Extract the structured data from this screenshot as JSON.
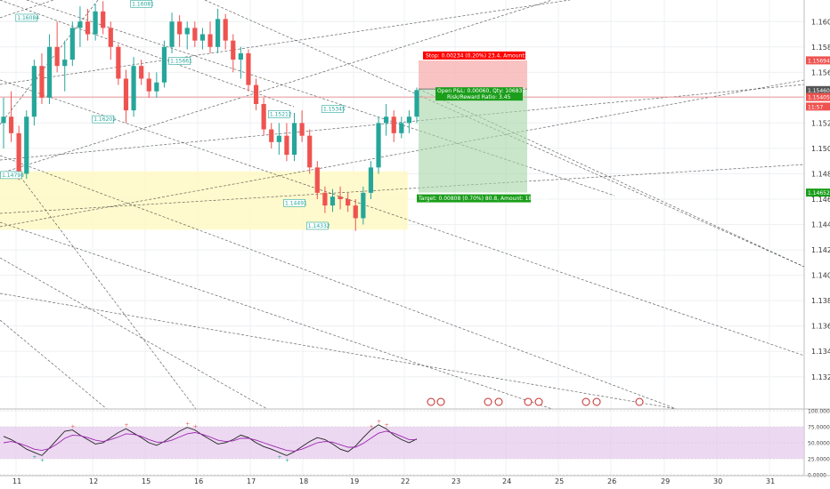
{
  "colors": {
    "up": "#26a69a",
    "down": "#ef5350",
    "stop_zone": "#f8b4b4",
    "target_zone": "#a5d6a7",
    "demand_zone": "#fff9c4",
    "stop_label_bg": "#ff0000",
    "target_label_bg": "#1b9e1b",
    "price_tag_red": "#ef5350",
    "price_tag_green": "#1b9e1b",
    "price_tag_gray": "#555555",
    "oscillator_band": "#e6c8ec"
  },
  "chart_data": [
    {
      "type": "candlestick",
      "symbol": "",
      "y_range": [
        1.1296,
        1.1617
      ],
      "y_ticks": [
        "1.16000",
        "1.15800",
        "1.15600",
        "1.15400",
        "1.15200",
        "1.15000",
        "1.14800",
        "1.14600",
        "1.14400",
        "1.14200",
        "1.14000",
        "1.13800",
        "1.13600",
        "1.13400",
        "1.13200"
      ],
      "x_ticks": [
        "11",
        "12",
        "15",
        "16",
        "17",
        "18",
        "19",
        "22",
        "23",
        "24",
        "25",
        "26",
        "29",
        "30",
        "31"
      ],
      "grid": true,
      "ohlc": [
        [
          1.152,
          1.154,
          1.15,
          1.1525
        ],
        [
          1.1525,
          1.1545,
          1.1505,
          1.1512
        ],
        [
          1.1512,
          1.1518,
          1.1475,
          1.148
        ],
        [
          1.148,
          1.153,
          1.1476,
          1.1525
        ],
        [
          1.1525,
          1.157,
          1.1518,
          1.1565
        ],
        [
          1.1565,
          1.1575,
          1.1535,
          1.154
        ],
        [
          1.154,
          1.159,
          1.1535,
          1.158
        ],
        [
          1.158,
          1.16,
          1.156,
          1.1565
        ],
        [
          1.1565,
          1.1585,
          1.1545,
          1.157
        ],
        [
          1.157,
          1.16,
          1.1565,
          1.1595
        ],
        [
          1.1595,
          1.1612,
          1.158,
          1.16
        ],
        [
          1.16,
          1.161,
          1.1585,
          1.159
        ],
        [
          1.159,
          1.1614,
          1.1585,
          1.1608
        ],
        [
          1.1608,
          1.1616,
          1.159,
          1.1595
        ],
        [
          1.1595,
          1.16,
          1.157,
          1.158
        ],
        [
          1.158,
          1.1582,
          1.155,
          1.1555
        ],
        [
          1.1555,
          1.1562,
          1.152,
          1.153
        ],
        [
          1.153,
          1.1572,
          1.1525,
          1.1565
        ],
        [
          1.1565,
          1.157,
          1.155,
          1.1555
        ],
        [
          1.1555,
          1.156,
          1.154,
          1.1545
        ],
        [
          1.1545,
          1.156,
          1.154,
          1.1552
        ],
        [
          1.1552,
          1.1585,
          1.1548,
          1.158
        ],
        [
          1.158,
          1.1607,
          1.1575,
          1.16
        ],
        [
          1.16,
          1.1605,
          1.158,
          1.159
        ],
        [
          1.159,
          1.16,
          1.1578,
          1.1595
        ],
        [
          1.1595,
          1.16,
          1.158,
          1.1585
        ],
        [
          1.1585,
          1.1595,
          1.1578,
          1.159
        ],
        [
          1.159,
          1.16,
          1.1575,
          1.158
        ],
        [
          1.158,
          1.161,
          1.1575,
          1.1602
        ],
        [
          1.1602,
          1.1606,
          1.1578,
          1.1585
        ],
        [
          1.1585,
          1.159,
          1.156,
          1.157
        ],
        [
          1.157,
          1.158,
          1.1555,
          1.1575
        ],
        [
          1.1575,
          1.1578,
          1.1545,
          1.155
        ],
        [
          1.155,
          1.1555,
          1.153,
          1.1535
        ],
        [
          1.1535,
          1.154,
          1.151,
          1.1515
        ],
        [
          1.1515,
          1.152,
          1.15,
          1.1505
        ],
        [
          1.1505,
          1.152,
          1.1495,
          1.151
        ],
        [
          1.151,
          1.152,
          1.149,
          1.1495
        ],
        [
          1.1495,
          1.1528,
          1.149,
          1.152
        ],
        [
          1.152,
          1.153,
          1.1505,
          1.151
        ],
        [
          1.151,
          1.1515,
          1.148,
          1.1485
        ],
        [
          1.1485,
          1.149,
          1.146,
          1.1465
        ],
        [
          1.1465,
          1.147,
          1.1449,
          1.1455
        ],
        [
          1.1455,
          1.1468,
          1.145,
          1.1462
        ],
        [
          1.1462,
          1.147,
          1.1452,
          1.146
        ],
        [
          1.146,
          1.1465,
          1.145,
          1.1455
        ],
        [
          1.1455,
          1.146,
          1.1435,
          1.1445
        ],
        [
          1.1445,
          1.147,
          1.144,
          1.1465
        ],
        [
          1.1465,
          1.149,
          1.146,
          1.1485
        ],
        [
          1.1485,
          1.1525,
          1.148,
          1.152
        ],
        [
          1.152,
          1.1535,
          1.151,
          1.1525
        ],
        [
          1.1525,
          1.153,
          1.1505,
          1.1512
        ],
        [
          1.1512,
          1.1525,
          1.1508,
          1.152
        ],
        [
          1.152,
          1.153,
          1.1512,
          1.1525
        ],
        [
          1.1525,
          1.1548,
          1.152,
          1.1546
        ]
      ],
      "price_labels": [
        {
          "text": "1.16084",
          "date_index": 3,
          "price": 1.1603
        },
        {
          "text": "1.16081",
          "date_index": 18,
          "price": 1.1614
        },
        {
          "text": "1.15661",
          "date_index": 23,
          "price": 1.1569
        },
        {
          "text": "1.16202",
          "date_index": 13,
          "price": 1.1523
        },
        {
          "text": "1.14798",
          "date_index": 1,
          "price": 1.1479
        },
        {
          "text": "1.15212",
          "date_index": 36,
          "price": 1.1527
        },
        {
          "text": "1.15345",
          "date_index": 43,
          "price": 1.1531
        },
        {
          "text": "1.14491",
          "date_index": 38,
          "price": 1.1457
        },
        {
          "text": "1.14332",
          "date_index": 41,
          "price": 1.1439
        }
      ],
      "position": {
        "entry": 1.15468,
        "stop": 1.15694,
        "target": 1.14652,
        "stop_label": "Stop: 0.00234 (0.20%) 23.4, Amount: 750",
        "target_label": "Target: 0.00808 (0.70%) 80.8, Amount: 1863.24",
        "pnl_label": "Open P&L: 0.00060, Qty: 106837",
        "rr_label": "Risk/Reward Ratio: 3.45"
      },
      "price_tags": [
        {
          "text": "1.15694",
          "price": 1.15694,
          "kind": "red"
        },
        {
          "text": "1.15460",
          "price": 1.1546,
          "kind": "gray"
        },
        {
          "text": "1.15405",
          "price": 1.15405,
          "kind": "red"
        },
        {
          "text": "11:57",
          "price": 1.1533,
          "kind": "red"
        },
        {
          "text": "1.14652",
          "price": 1.14652,
          "kind": "green"
        }
      ],
      "demand_zone": {
        "from": 1.1436,
        "to": 1.1482
      },
      "horizontal_line": 1.15405
    },
    {
      "type": "line",
      "indicator": "oscillator",
      "y_range": [
        0,
        100
      ],
      "y_ticks": [
        "100.0000",
        "75.0000",
        "50.0000",
        "25.0000",
        "0.0000"
      ],
      "band": [
        25,
        75
      ],
      "series": [
        {
          "values": [
            60,
            55,
            48,
            40,
            35,
            30,
            42,
            55,
            68,
            70,
            62,
            55,
            48,
            50,
            58,
            66,
            72,
            65,
            58,
            50,
            46,
            52,
            60,
            68,
            74,
            70,
            62,
            55,
            48,
            50,
            55,
            62,
            58,
            50,
            44,
            40,
            35,
            30,
            36,
            44,
            52,
            58,
            55,
            48,
            40,
            36,
            45,
            58,
            70,
            78,
            72,
            62,
            55,
            50,
            56
          ]
        },
        {
          "values": [
            50,
            52,
            49,
            45,
            40,
            38,
            41,
            48,
            57,
            62,
            61,
            58,
            54,
            52,
            55,
            59,
            64,
            63,
            60,
            55,
            51,
            51,
            54,
            59,
            64,
            66,
            63,
            59,
            54,
            52,
            53,
            57,
            57,
            54,
            50,
            46,
            42,
            38,
            37,
            40,
            45,
            50,
            52,
            51,
            47,
            43,
            43,
            49,
            57,
            65,
            68,
            65,
            60,
            55,
            55
          ]
        }
      ]
    }
  ]
}
